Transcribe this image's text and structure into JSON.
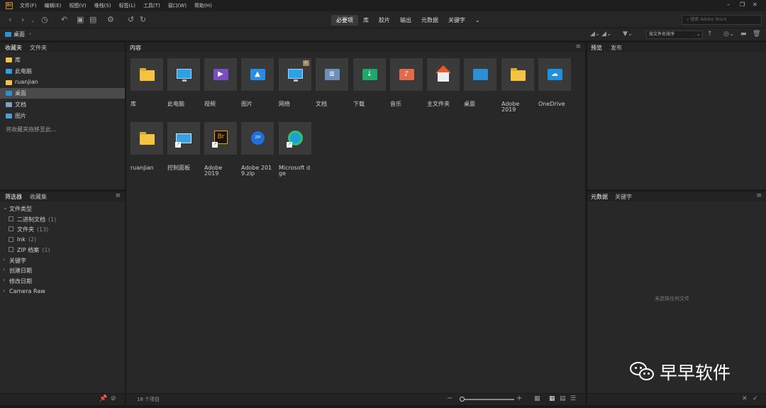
{
  "app": {
    "icon_text": "Br"
  },
  "menu": [
    "文件(F)",
    "编辑(E)",
    "视图(V)",
    "堆栈(S)",
    "标签(L)",
    "工具(T)",
    "窗口(W)",
    "帮助(H)"
  ],
  "workspaces": {
    "items": [
      "必要项",
      "库",
      "胶片",
      "输出",
      "元数据",
      "关键字"
    ],
    "active_index": 0
  },
  "search": {
    "placeholder": "搜索 Adobe Stock"
  },
  "path": {
    "current": "桌面",
    "separator": "›"
  },
  "sort": {
    "label": "按文件名排序"
  },
  "favorites_panel": {
    "tabs": [
      "收藏夹",
      "文件夹"
    ],
    "items": [
      {
        "label": "库",
        "color": "#f2c14b"
      },
      {
        "label": "此电脑",
        "color": "#2ea0e6"
      },
      {
        "label": "ruanjian",
        "color": "#f2c14b"
      },
      {
        "label": "桌面",
        "color": "#2d8fd5",
        "selected": true
      },
      {
        "label": "文档",
        "color": "#7c9fc4"
      },
      {
        "label": "图片",
        "color": "#4a9fd8"
      }
    ],
    "hint": "将收藏夹拖移至此..."
  },
  "filter_panel": {
    "tabs": [
      "筛选器",
      "收藏集"
    ],
    "file_type": {
      "label": "文件类型",
      "options": [
        {
          "label": "二进制文档",
          "count": "(1)"
        },
        {
          "label": "文件夹",
          "count": "(13)"
        },
        {
          "label": "lnk",
          "count": "(2)"
        },
        {
          "label": "ZIP 档案",
          "count": "(1)"
        }
      ]
    },
    "groups": [
      "关键字",
      "创建日期",
      "修改日期",
      "Camera Raw"
    ]
  },
  "content_panel": {
    "tab": "内容",
    "items": [
      {
        "label": "库",
        "icon": "folder-icon"
      },
      {
        "label": "此电脑",
        "icon": "monitor-icon"
      },
      {
        "label": "视频",
        "icon": "video-folder-icon"
      },
      {
        "label": "图片",
        "icon": "pictures-folder-icon"
      },
      {
        "label": "网络",
        "icon": "network-icon"
      },
      {
        "label": "文档",
        "icon": "documents-folder-icon"
      },
      {
        "label": "下载",
        "icon": "downloads-folder-icon"
      },
      {
        "label": "音乐",
        "icon": "music-folder-icon"
      },
      {
        "label": "主文件夹",
        "icon": "home-icon"
      },
      {
        "label": "桌面",
        "icon": "desktop-folder-icon"
      },
      {
        "label": "Adobe 2019",
        "icon": "folder-icon"
      },
      {
        "label": "OneDrive",
        "icon": "onedrive-icon"
      },
      {
        "label": "ruanjian",
        "icon": "folder-icon"
      },
      {
        "label": "控制面板",
        "icon": "control-panel-icon"
      },
      {
        "label": "Adobe 2019",
        "icon": "bridge-shortcut-icon"
      },
      {
        "label": "Adobe 2019.zip",
        "icon": "zip-icon"
      },
      {
        "label": "Microsoft dge",
        "icon": "edge-shortcut-icon"
      }
    ],
    "status": "18 个项目"
  },
  "preview_panel": {
    "tabs": [
      "预览",
      "发布"
    ]
  },
  "metadata_panel": {
    "tabs": [
      "元数据",
      "关键字"
    ],
    "empty_text": "未选择任何文件"
  },
  "watermark": {
    "text": "早早软件"
  }
}
